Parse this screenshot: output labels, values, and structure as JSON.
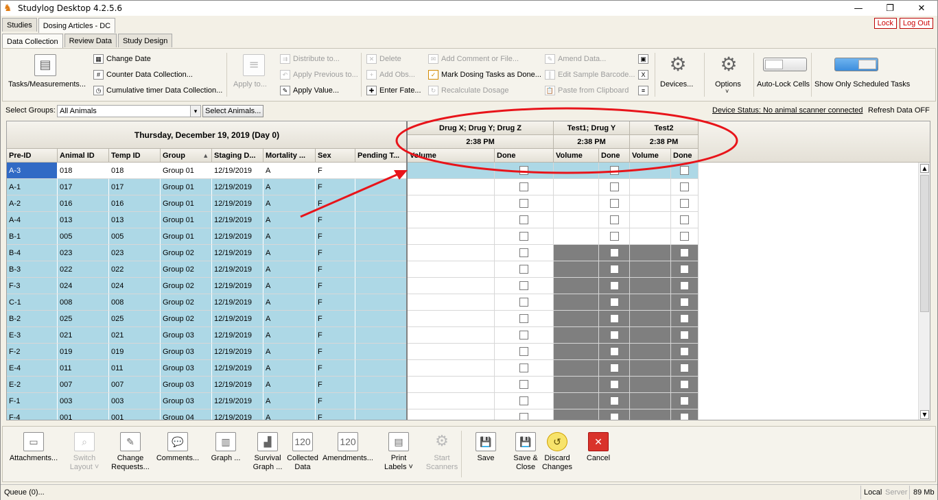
{
  "app": {
    "title": "Studylog Desktop 4.2.5.6"
  },
  "window_controls": {
    "minimize": "—",
    "restore": "❐",
    "close": "✕"
  },
  "top_tabs": [
    {
      "label": "Studies"
    },
    {
      "label": "Dosing Articles - DC"
    }
  ],
  "lock_buttons": {
    "lock": "Lock",
    "logout": "Log Out"
  },
  "sub_tabs": [
    {
      "label": "Data Collection"
    },
    {
      "label": "Review Data"
    },
    {
      "label": "Study Design"
    }
  ],
  "toolbar": {
    "tasks": "Tasks/Measurements...",
    "change_date": "Change Date",
    "counter": "Counter Data Collection...",
    "cumulative": "Cumulative timer Data Collection...",
    "apply_to": "Apply to...",
    "distribute": "Distribute to...",
    "apply_previous": "Apply Previous to...",
    "apply_value": "Apply Value...",
    "delete": "Delete",
    "add_obs": "Add Obs...",
    "enter_fate": "Enter Fate...",
    "add_comment": "Add Comment or File...",
    "mark_dosing": "Mark Dosing Tasks as Done...",
    "recalc": "Recalculate Dosage",
    "amend": "Amend Data...",
    "edit_barcode": "Edit Sample Barcode...",
    "paste": "Paste from Clipboard",
    "devices": "Devices...",
    "options": "Options",
    "autolock": "Auto-Lock Cells",
    "show_only": "Show Only Scheduled Tasks"
  },
  "groups": {
    "label": "Select Groups:",
    "value": "All Animals",
    "select_btn": "Select Animals...",
    "device_status": "Device Status: No animal scanner connected",
    "refresh": "Refresh Data OFF"
  },
  "grid": {
    "date_header": "Thursday, December 19, 2019 (Day 0)",
    "columns": [
      "Pre-ID",
      "Animal ID",
      "Temp ID",
      "Group",
      "Staging D...",
      "Mortality ...",
      "Sex",
      "Pending T..."
    ],
    "dose_groups": [
      {
        "name": "Drug X; Drug Y; Drug Z",
        "time": "2:38 PM",
        "volume": "Volume",
        "done": "Done"
      },
      {
        "name": "Test1; Drug Y",
        "time": "2:38 PM",
        "volume": "Volume",
        "done": "Done"
      },
      {
        "name": "Test2",
        "time": "2:38 PM",
        "volume": "Volume",
        "done": "Done"
      }
    ],
    "rows": [
      {
        "pre": "A-3",
        "aid": "018",
        "tid": "018",
        "grp": "Group 01",
        "stg": "12/19/2019",
        "mort": "A",
        "sex": "F"
      },
      {
        "pre": "A-1",
        "aid": "017",
        "tid": "017",
        "grp": "Group 01",
        "stg": "12/19/2019",
        "mort": "A",
        "sex": "F"
      },
      {
        "pre": "A-2",
        "aid": "016",
        "tid": "016",
        "grp": "Group 01",
        "stg": "12/19/2019",
        "mort": "A",
        "sex": "F"
      },
      {
        "pre": "A-4",
        "aid": "013",
        "tid": "013",
        "grp": "Group 01",
        "stg": "12/19/2019",
        "mort": "A",
        "sex": "F"
      },
      {
        "pre": "B-1",
        "aid": "005",
        "tid": "005",
        "grp": "Group 01",
        "stg": "12/19/2019",
        "mort": "A",
        "sex": "F"
      },
      {
        "pre": "B-4",
        "aid": "023",
        "tid": "023",
        "grp": "Group 02",
        "stg": "12/19/2019",
        "mort": "A",
        "sex": "F"
      },
      {
        "pre": "B-3",
        "aid": "022",
        "tid": "022",
        "grp": "Group 02",
        "stg": "12/19/2019",
        "mort": "A",
        "sex": "F"
      },
      {
        "pre": "F-3",
        "aid": "024",
        "tid": "024",
        "grp": "Group 02",
        "stg": "12/19/2019",
        "mort": "A",
        "sex": "F"
      },
      {
        "pre": "C-1",
        "aid": "008",
        "tid": "008",
        "grp": "Group 02",
        "stg": "12/19/2019",
        "mort": "A",
        "sex": "F"
      },
      {
        "pre": "B-2",
        "aid": "025",
        "tid": "025",
        "grp": "Group 02",
        "stg": "12/19/2019",
        "mort": "A",
        "sex": "F"
      },
      {
        "pre": "E-3",
        "aid": "021",
        "tid": "021",
        "grp": "Group 03",
        "stg": "12/19/2019",
        "mort": "A",
        "sex": "F"
      },
      {
        "pre": "F-2",
        "aid": "019",
        "tid": "019",
        "grp": "Group 03",
        "stg": "12/19/2019",
        "mort": "A",
        "sex": "F"
      },
      {
        "pre": "E-4",
        "aid": "011",
        "tid": "011",
        "grp": "Group 03",
        "stg": "12/19/2019",
        "mort": "A",
        "sex": "F"
      },
      {
        "pre": "E-2",
        "aid": "007",
        "tid": "007",
        "grp": "Group 03",
        "stg": "12/19/2019",
        "mort": "A",
        "sex": "F"
      },
      {
        "pre": "F-1",
        "aid": "003",
        "tid": "003",
        "grp": "Group 03",
        "stg": "12/19/2019",
        "mort": "A",
        "sex": "F"
      },
      {
        "pre": "F-4",
        "aid": "001",
        "tid": "001",
        "grp": "Group 04",
        "stg": "12/19/2019",
        "mort": "A",
        "sex": "F"
      }
    ]
  },
  "bottom": {
    "attachments": "Attachments...",
    "switch_layout": "Switch Layout ˅",
    "change_requests": "Change Requests...",
    "comments": "Comments...",
    "graph": "Graph ...",
    "survival": "Survival Graph ...",
    "collected": "Collected Data",
    "amendments": "Amendments...",
    "print_labels": "Print Labels ˅",
    "start_scanners": "Start Scanners",
    "save": "Save",
    "save_close": "Save & Close",
    "discard": "Discard Changes",
    "cancel": "Cancel"
  },
  "status": {
    "queue": "Queue (0)...",
    "local": "Local",
    "server": "Server",
    "memory": "89 Mb"
  },
  "colors": {
    "row_blue": "#add8e6",
    "selected": "#316ac5",
    "grey_block": "#7f7f7f",
    "annotation": "#e8141a"
  }
}
